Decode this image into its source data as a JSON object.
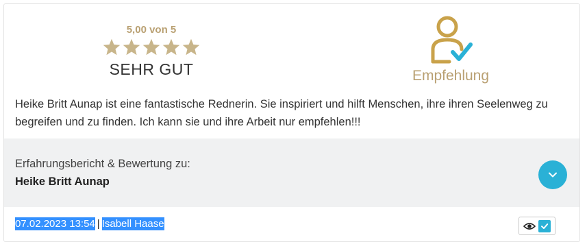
{
  "rating": {
    "score_text": "5,00 von 5",
    "stars_filled": 5,
    "stars_total": 5,
    "label": "SEHR GUT",
    "star_color": "#c8b58a"
  },
  "recommendation": {
    "label": "Empfehlung",
    "icon": "user-check-icon",
    "color": "#c9a24a",
    "check_color": "#2ab1d6"
  },
  "review": {
    "text": "Heike Britt Aunap ist eine fantastische Rednerin. Sie inspiriert und hilft Menschen, ihre ihren Seelenweg zu begreifen und zu finden. Ich kann sie und ihre Arbeit nur empfehlen!!!"
  },
  "subject": {
    "intro": "Erfahrungsbericht & Bewertung zu:",
    "name": "Heike Britt Aunap",
    "toggle_icon": "chevron-down-icon"
  },
  "meta": {
    "datetime": "07.02.2023 13:54",
    "separator": "|",
    "author": "Isabell Haase"
  },
  "actions": {
    "view_icon": "eye-icon",
    "check_icon": "checkbox-icon",
    "accent": "#2ab1d6"
  }
}
